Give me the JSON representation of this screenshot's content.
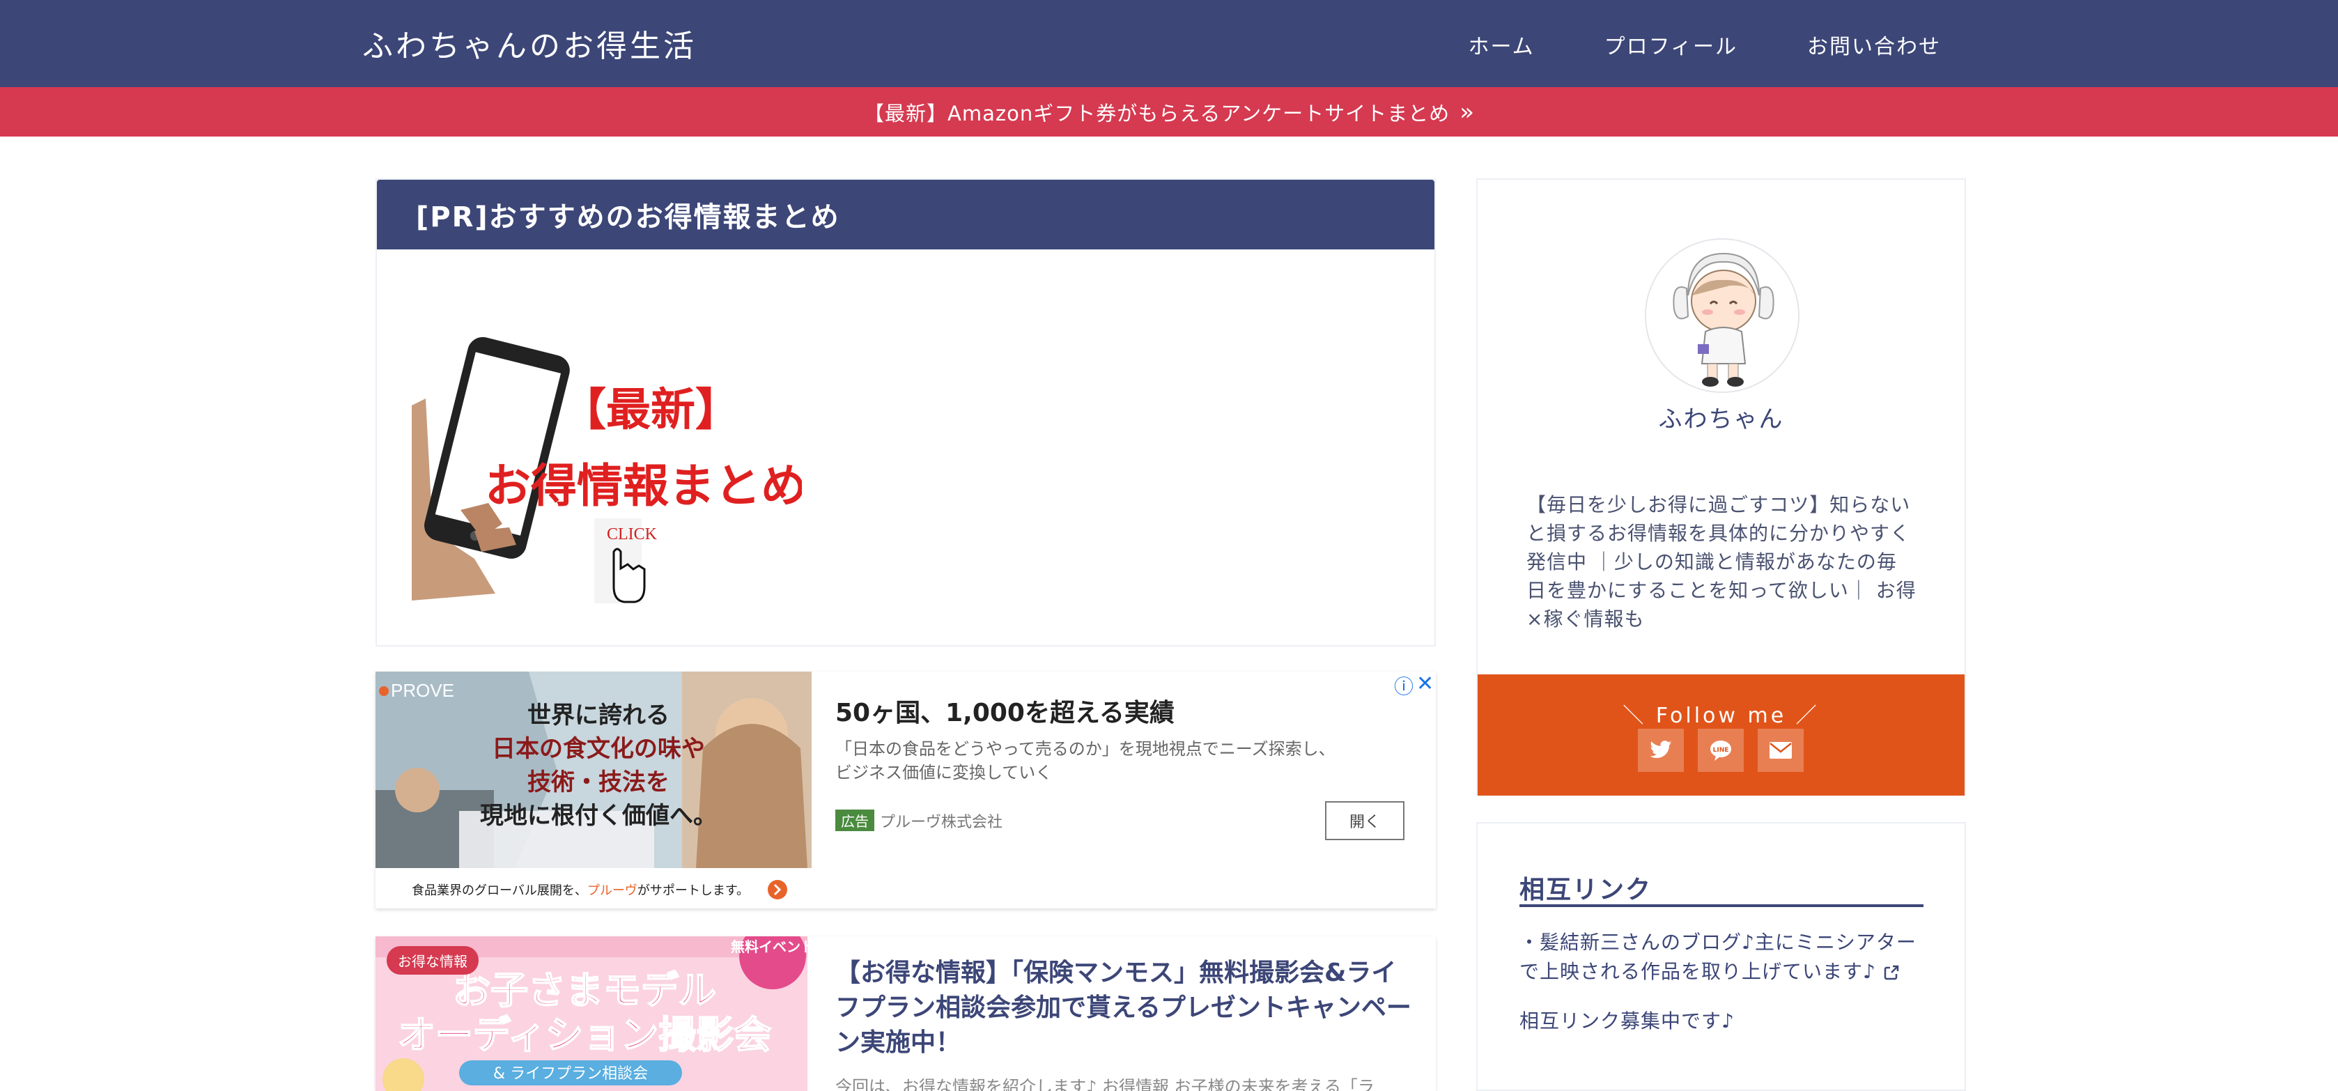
{
  "colors": {
    "navy": "#3c4677",
    "red": "#d53a50",
    "orange": "#e0541a",
    "ad_blue": "#1a73e8"
  },
  "header": {
    "site_title": "ふわちゃんのお得生活",
    "nav": [
      "ホーム",
      "プロフィール",
      "お問い合わせ"
    ]
  },
  "notice": {
    "text": "【最新】Amazonギフト券がもらえるアンケートサイトまとめ",
    "icon": "double-chevron-right-icon"
  },
  "pr": {
    "title": "[PR]おすすめのお得情報まとめ",
    "image_line1": "【最新】",
    "image_line2": "お得情報まとめ",
    "image_click": "CLICK"
  },
  "ad": {
    "brand": "PROVE",
    "image_lines": [
      "世界に誇れる",
      "日本の食文化の味や",
      "技術・技法を",
      "現地に根付く価値へ。"
    ],
    "image_caption_pre": "食品業界のグローバル展開を、",
    "image_caption_brand": "プルーヴ",
    "image_caption_post": "がサポートします。",
    "headline": "50ヶ国、1,000を超える実績",
    "description": "「日本の食品をどうやって売るのか」を現地視点でニーズ探索し、ビジネス価値に変換していく",
    "tag": "広告",
    "company": "プルーヴ株式会社",
    "open_button": "開く",
    "info_icon": "ⓘ",
    "close_icon": "✕"
  },
  "article": {
    "category": "お得な情報",
    "thumb_badge": "無料イベント",
    "thumb_line1": "お子さまモデル",
    "thumb_line2": "オーディション撮影会",
    "thumb_line3": "& ライフプラン相談会",
    "title": "【お得な情報】「保険マンモス」無料撮影会&ライフプラン相談会参加で貰えるプレゼントキャンペーン実施中！",
    "excerpt": "今回は、お得な情報を紹介します♪ お得情報 お子様の未来を考える「ラ"
  },
  "profile": {
    "name": "ふわちゃん",
    "description": "【毎日を少しお得に過ごすコツ】知らないと損するお得情報を具体的に分かりやすく発信中 ｜少しの知識と情報があなたの毎日を豊かにすることを知って欲しい｜ お得×稼ぐ情報も",
    "follow_title": "＼ Follow me ／",
    "follow_icons": [
      "twitter-icon",
      "line-icon",
      "mail-icon"
    ]
  },
  "links": {
    "title": "相互リンク",
    "item1": "・髪結新三さんのブログ♪主にミニシアターで上映される作品を取り上げています♪",
    "item2": "相互リンク募集中です♪"
  }
}
